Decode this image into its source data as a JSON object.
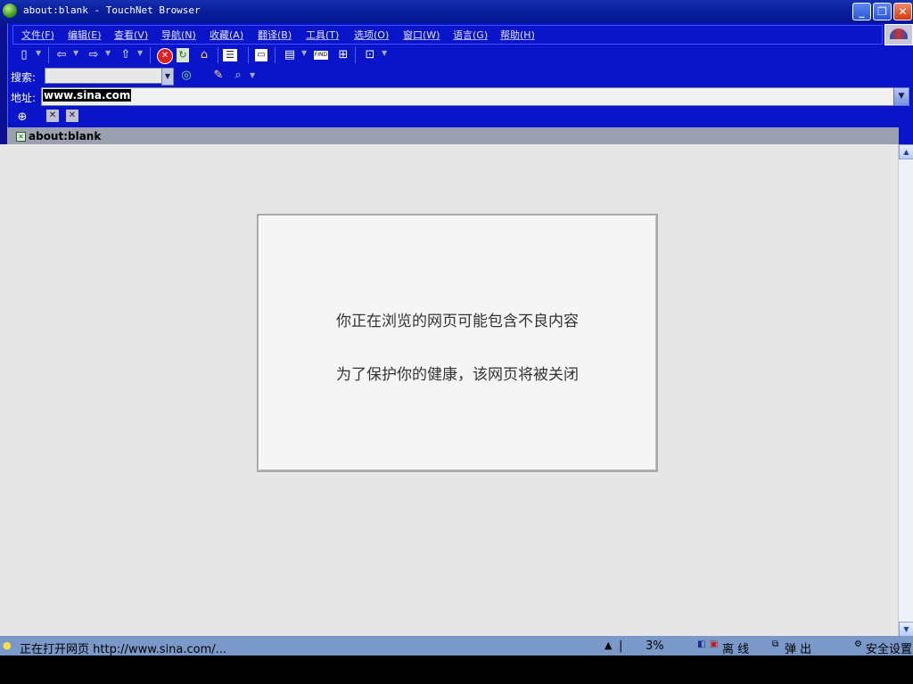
{
  "window": {
    "title": "about:blank - TouchNet Browser"
  },
  "menu": [
    "文件(F)",
    "编辑(E)",
    "查看(V)",
    "导航(N)",
    "收藏(A)",
    "翻译(B)",
    "工具(T)",
    "选项(O)",
    "窗口(W)",
    "语言(G)",
    "帮助(H)"
  ],
  "search": {
    "label": "搜索:",
    "value": ""
  },
  "address": {
    "label": "地址:",
    "value": "www.sina.com"
  },
  "tab": {
    "label": "about:blank"
  },
  "content": {
    "line1": "你正在浏览的网页可能包含不良内容",
    "line2": "为了保护你的健康，该网页将被关闭"
  },
  "status": {
    "text": "正在打开网页 http://www.sina.com/...",
    "progress": "3%",
    "mode": "离 线",
    "popup": "弹 出",
    "security": "安全设置"
  },
  "colors": {
    "chrome": "#0a14c8",
    "titlebar": "#0a1f9c",
    "statusbar": "#7a99c8",
    "content_bg": "#e6e6e6"
  }
}
